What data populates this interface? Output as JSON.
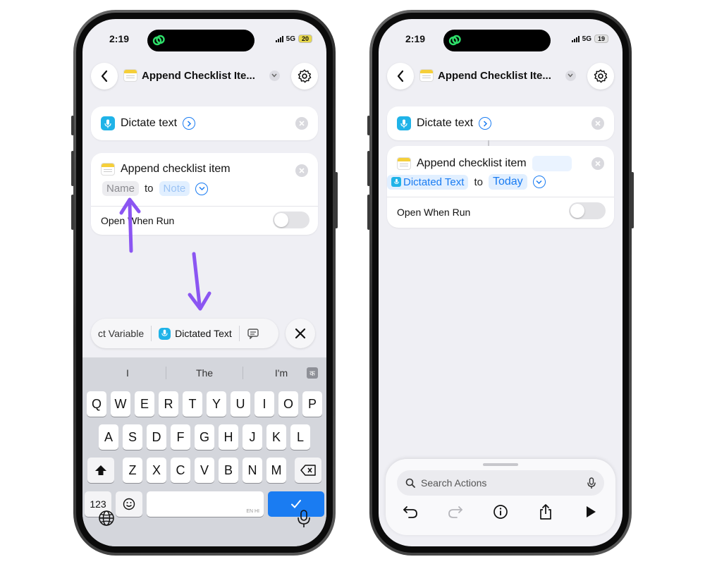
{
  "left_phone": {
    "status": {
      "time": "2:19",
      "network": "5G",
      "battery": "20"
    },
    "nav": {
      "title": "Append Checklist Ite..."
    },
    "dictate_card": {
      "label": "Dictate text"
    },
    "append_card": {
      "label": "Append checklist item",
      "param_name": "Name",
      "connector": "to",
      "param_note": "Note",
      "open_when_run": "Open When Run"
    },
    "variable_bar": {
      "item_variable": "ct Variable",
      "item_dictated": "Dictated Text"
    },
    "keyboard": {
      "suggestions": [
        "I",
        "The",
        "I'm"
      ],
      "lang_badge": "क",
      "row1": [
        "Q",
        "W",
        "E",
        "R",
        "T",
        "Y",
        "U",
        "I",
        "O",
        "P"
      ],
      "row2": [
        "A",
        "S",
        "D",
        "F",
        "G",
        "H",
        "J",
        "K",
        "L"
      ],
      "row3": [
        "Z",
        "X",
        "C",
        "V",
        "B",
        "N",
        "M"
      ],
      "num_key": "123",
      "space_hint": "EN HI"
    }
  },
  "right_phone": {
    "status": {
      "time": "2:19",
      "network": "5G",
      "battery": "19"
    },
    "nav": {
      "title": "Append Checklist Ite..."
    },
    "dictate_card": {
      "label": "Dictate text"
    },
    "append_card": {
      "label": "Append checklist item",
      "param_name": "Dictated Text",
      "connector": "to",
      "param_note": "Today",
      "open_when_run": "Open When Run"
    },
    "dock": {
      "search_placeholder": "Search Actions"
    }
  },
  "colors": {
    "accent": "#1a7cf2",
    "annotation_arrow": "#8b55f2",
    "dictate_icon": "#1fb3e8"
  }
}
